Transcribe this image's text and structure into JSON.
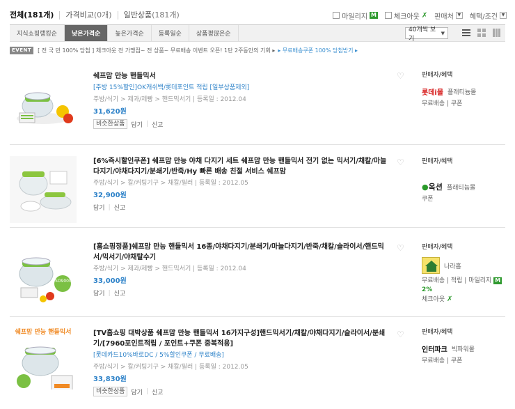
{
  "top_tabs": [
    {
      "label": "전체",
      "count": "(181개)"
    },
    {
      "label": "가격비교",
      "count": "(0개)"
    },
    {
      "label": "일반상품",
      "count": "(181개)"
    }
  ],
  "filters": {
    "mileage_label": "마일리지",
    "mileage_badge": "M",
    "checkout_label": "체크아웃",
    "seller_label": "판매처",
    "benefit_label": "혜택/조건"
  },
  "sort_tabs": [
    "지식쇼핑랭킹순",
    "낮은가격순",
    "높은가격순",
    "등록일순",
    "상품평많은순"
  ],
  "active_sort": "낮은가격순",
  "view_select": "40개씩 보기",
  "event": {
    "tag": "EVENT",
    "text": "[ 전 국 민 100% 당첨 ] 체크아웃 전 가맹점~ 전 상품~ 무료배송 이벤트 오픈! 1탄 2주동안의 기회 ▸",
    "link": "▸ 무료배송쿠폰 100% 당첨받기 ▸"
  },
  "items": [
    {
      "title": "쉐프맘 만능 핸들믹서",
      "subtitle": "[주방 15%할인]OK캐쉬백/롯데포인트 적립 [일부상품제외]",
      "category": "주방/식기 > 제과/제빵 > 핸드믹서기 | 등록일 : 2012.04",
      "price": "31,620원",
      "similar": "비슷한상품",
      "save": "담기",
      "report": "신고",
      "seller_head": "판매자/혜택",
      "seller_name": "롯데i몰",
      "seller_tier": "플래티늄몰",
      "seller_extra": "무료배송 | 쿠폰"
    },
    {
      "title": "[6%즉시할인쿠폰] 쉐프맘 만능 야채 다지기 세트 쉐프맘 만능 핸들믹서 전기 없는 믹서기/채칼/마늘다지기/야채다지기/분쇄기/반죽/Hy 빠른 배송 친절 서비스 쉐프맘",
      "category": "주방/식기 > 칼/커팅기구 > 채칼/필러 | 등록일 : 2012.05",
      "price": "32,900원",
      "save": "담기",
      "report": "신고",
      "seller_head": "판매자/혜택",
      "seller_name": "옥션",
      "seller_tier": "플래티늄몰",
      "seller_extra": "쿠폰"
    },
    {
      "title": "[홈쇼핑정품]쉐프맘 만능 핸들믹서 16종/야채다지기/분쇄기/마늘다지기/반죽/채칼/슬라이서/핸드믹서/믹서기/야채탈수기",
      "category": "주방/식기 > 제과/제빵 > 핸드믹서기 | 등록일 : 2012.04",
      "price": "33,000원",
      "save": "담기",
      "report": "신고",
      "seller_head": "판매자/혜택",
      "seller_name": "나라홈",
      "seller_extra": "무료배송 | 적립 | 마일리지",
      "seller_badge": "M",
      "seller_pct": "2%",
      "seller_extra2": "체크아웃"
    },
    {
      "title": "[TV홈쇼핑 대박상품 쉐프맘 만능 핸들믹서 16가지구성]핸드믹서기/채칼/야채다지기/슬라이서/분쇄기/[7960포인트적립 / 포인트+쿠폰 중복적용]",
      "subtitle": "[롯데카드10%바로DC / 5%할인쿠폰 / 무료배송]",
      "category": "주방/식기 > 칼/커팅기구 > 채칼/필러 | 등록일 : 2012.05",
      "price": "33,830원",
      "similar": "비슷한상품",
      "save": "담기",
      "report": "신고",
      "seller_head": "판매자/혜택",
      "seller_name": "인터파크",
      "seller_tier": "빅파워몰",
      "seller_extra": "무료배송 | 쿠폰"
    }
  ],
  "thumb4_banner": "쉐프맘 만능 핸들믹서",
  "colors": {
    "accent_blue": "#2f83c9",
    "active_sort_bg": "#666666",
    "mileage_green": "#2f9a2f"
  }
}
